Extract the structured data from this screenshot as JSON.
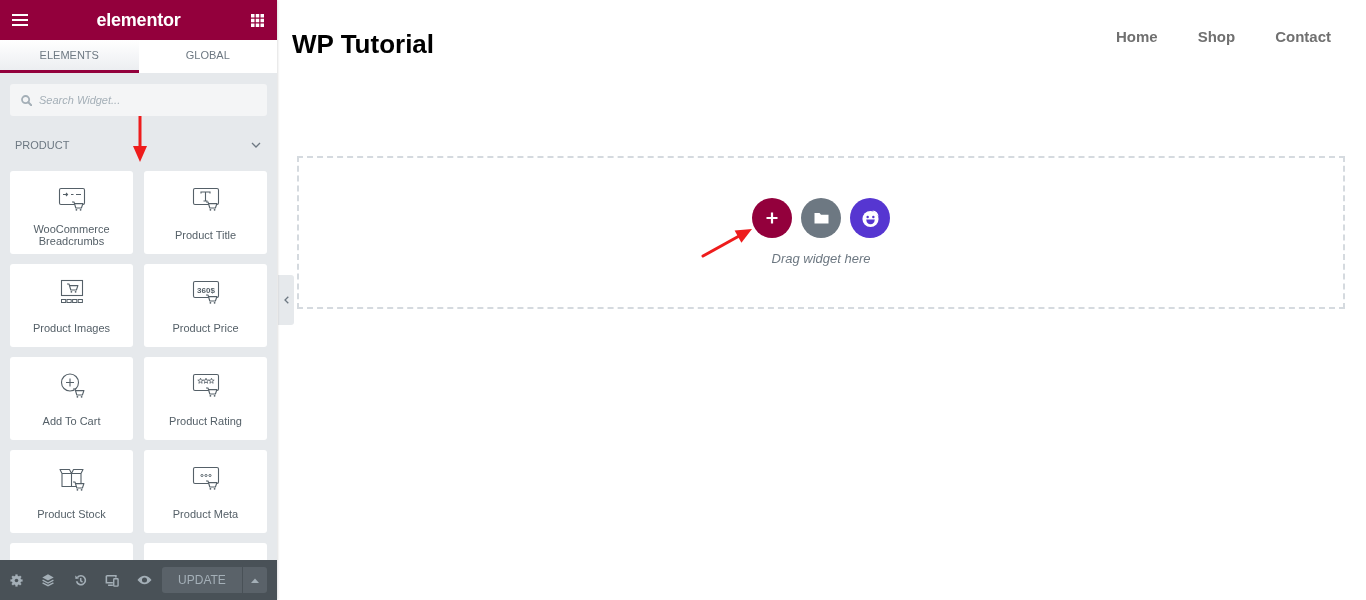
{
  "panel": {
    "logo": "elementor",
    "tabs": [
      {
        "label": "ELEMENTS",
        "selected": true
      },
      {
        "label": "GLOBAL",
        "selected": false
      }
    ],
    "search": {
      "placeholder": "Search Widget..."
    },
    "section": {
      "title": "PRODUCT",
      "expanded": true
    },
    "widgets": [
      {
        "label": "WooCommerce Breadcrumbs"
      },
      {
        "label": "Product Title"
      },
      {
        "label": "Product Images"
      },
      {
        "label": "Product Price"
      },
      {
        "label": "Add To Cart"
      },
      {
        "label": "Product Rating"
      },
      {
        "label": "Product Stock"
      },
      {
        "label": "Product Meta"
      }
    ],
    "price_icon": {
      "text": "360$"
    }
  },
  "footer": {
    "update_button": "UPDATE"
  },
  "site": {
    "title": "WP Tutorial",
    "nav": [
      "Home",
      "Shop",
      "Contact"
    ]
  },
  "drop_zone": {
    "hint": "Drag widget here"
  }
}
